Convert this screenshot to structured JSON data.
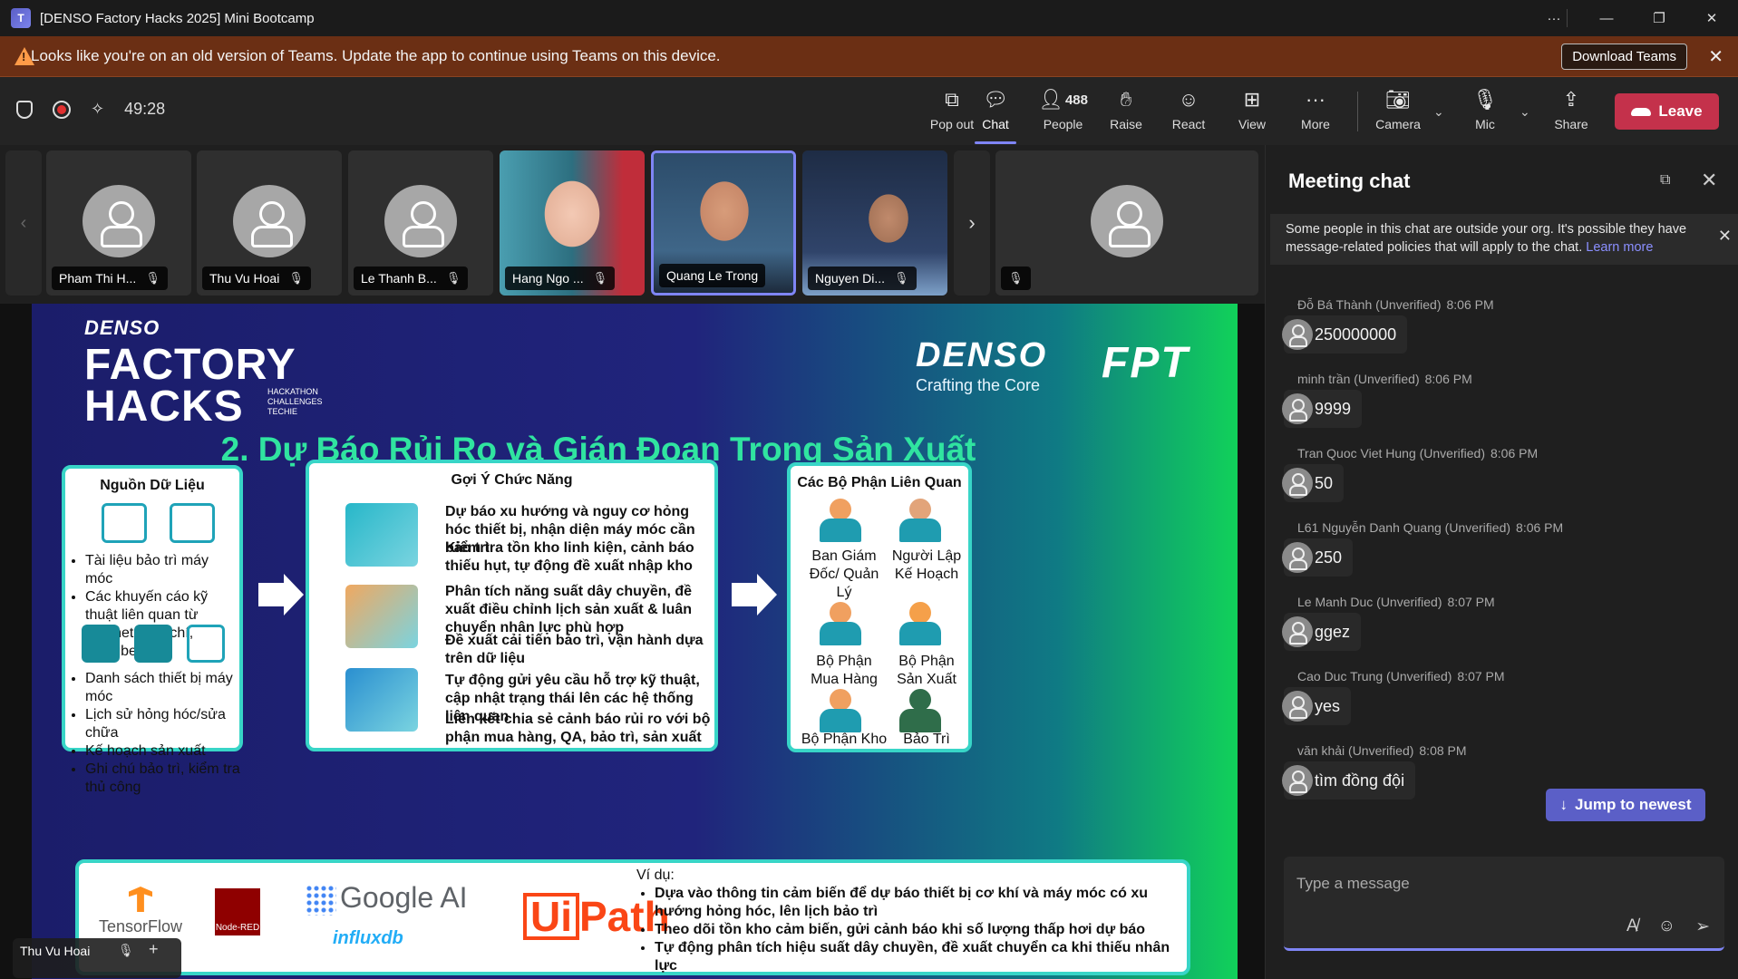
{
  "window": {
    "title": "[DENSO Factory Hacks 2025] Mini Bootcamp"
  },
  "banner": {
    "message": "Looks like you're on an old version of Teams. Update the app to continue using Teams on this device.",
    "download_label": "Download Teams"
  },
  "toolbar": {
    "timer": "49:28",
    "popout": "Pop out",
    "chat": "Chat",
    "people": "People",
    "people_count": "488",
    "raise": "Raise",
    "react": "React",
    "view": "View",
    "more": "More",
    "camera": "Camera",
    "mic": "Mic",
    "share": "Share",
    "leave": "Leave"
  },
  "participants": [
    {
      "name": "Pham Thi H...",
      "type": "avatar"
    },
    {
      "name": "Thu Vu Hoai",
      "type": "avatar"
    },
    {
      "name": "Le Thanh B...",
      "type": "avatar"
    },
    {
      "name": "Hang Ngo ...",
      "type": "video"
    },
    {
      "name": "Quang Le Trong",
      "type": "video"
    },
    {
      "name": "Nguyen Di...",
      "type": "video"
    }
  ],
  "slide": {
    "denso_small": "DENSO",
    "factory": "FACTORY",
    "hacks": "HACKS",
    "hacks_sub": [
      "HACKATHON",
      "CHALLENGES",
      "TECHIE"
    ],
    "denso_brand": "DENSO",
    "crafting": "Crafting the Core",
    "fpt": "FPT",
    "heading": "2. Dự Báo Rủi Ro và Gián Đoạn Trong Sản Xuất",
    "left_panel": {
      "title": "Nguồn Dữ Liệu",
      "list1": [
        "Tài liệu bảo trì máy móc",
        "Các khuyến cáo kỹ thuật liên quan từ internet, báo chí, youtube"
      ],
      "list2": [
        "Danh sách thiết bị máy móc",
        "Lịch sử hỏng hóc/sửa chữa",
        "Kế hoạch sản xuất",
        "Ghi chú bảo trì, kiểm tra thủ công"
      ]
    },
    "mid_panel": {
      "title": "Gợi Ý Chức Năng",
      "features": [
        "Dự báo xu hướng và nguy cơ hỏng hóc thiết bị, nhận diện máy móc cần bảo trì",
        "Kiểm tra tồn kho linh kiện, cảnh báo thiếu hụt, tự động đề xuất nhập kho",
        "Phân tích năng suất dây chuyền, đề xuất điều chỉnh lịch sản xuất & luân chuyển nhân lực phù hợp",
        "Đề xuất cải tiến bảo trì, vận hành dựa trên dữ liệu",
        "Tự động gửi yêu cầu hỗ trợ kỹ thuật, cập nhật trạng thái lên các hệ thống liên quan",
        "Liên kết chia sẻ cảnh báo rủi ro với bộ phận mua hàng, QA, bảo trì, sản xuất"
      ]
    },
    "right_panel": {
      "title": "Các Bộ Phận Liên Quan",
      "depts": [
        "Ban Giám Đốc/ Quản Lý",
        "Người Lập Kế Hoạch",
        "Bộ Phận Mua Hàng",
        "Bộ Phận Sản Xuất",
        "Bộ Phận Kho",
        "Bảo Trì"
      ]
    },
    "bottom": {
      "tensorflow": "TensorFlow",
      "nodered": "Node-RED",
      "googleai": "Google AI",
      "influx": "influxdb",
      "uipath_ui": "Ui",
      "uipath_path": "Path",
      "example_label": "Ví dụ:",
      "examples": [
        "Dựa vào thông tin cảm biến để dự báo thiết bị cơ khí và máy móc có xu hướng hỏng hóc, lên lịch bảo trì",
        "Theo dõi tồn kho cảm biến, gửi cảnh báo khi số lượng thấp hơi dự báo",
        "Tự động phân tích hiệu suất dây chuyền, đề xuất chuyển ca khi thiếu nhân lực"
      ]
    }
  },
  "self_view": {
    "name": "Thu Vu Hoai"
  },
  "chat": {
    "title": "Meeting chat",
    "notice": "Some people in this chat are outside your org. It's possible they have message-related policies that will apply to the chat.",
    "learn_more": "Learn more",
    "messages": [
      {
        "sender": "Đỗ Bá Thành (Unverified)",
        "time": "8:06 PM",
        "text": "250000000"
      },
      {
        "sender": "minh trần (Unverified)",
        "time": "8:06 PM",
        "text": "9999"
      },
      {
        "sender": "Tran Quoc Viet Hung (Unverified)",
        "time": "8:06 PM",
        "text": "50"
      },
      {
        "sender": "L61 Nguyễn Danh Quang (Unverified)",
        "time": "8:06 PM",
        "text": "250"
      },
      {
        "sender": "Le Manh Duc (Unverified)",
        "time": "8:07 PM",
        "text": "ggez"
      },
      {
        "sender": "Cao Duc Trung (Unverified)",
        "time": "8:07 PM",
        "text": "yes"
      },
      {
        "sender": "văn khải (Unverified)",
        "time": "8:08 PM",
        "text": "tìm đồng đội"
      }
    ],
    "jump_label": "Jump to newest",
    "compose_placeholder": "Type a message"
  },
  "colors": {
    "accent": "#7f85f5",
    "leave": "#c4314b",
    "banner": "#6b2f14",
    "slide_heading": "#30e4a0",
    "panel_border": "#38d5c7"
  }
}
